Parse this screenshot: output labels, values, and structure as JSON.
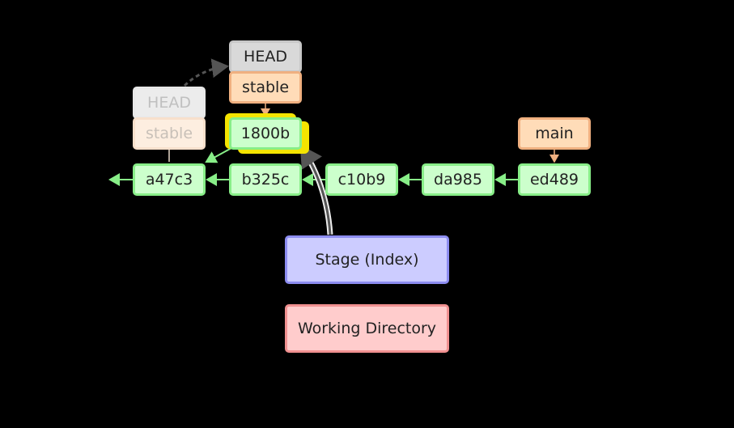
{
  "diagram": {
    "commits": [
      {
        "id": "a47c3"
      },
      {
        "id": "b325c"
      },
      {
        "id": "c10b9"
      },
      {
        "id": "da985"
      },
      {
        "id": "ed489"
      },
      {
        "id": "1800b",
        "highlighted": true
      }
    ],
    "refs": {
      "old_head": "HEAD",
      "old_branch": "stable",
      "new_head": "HEAD",
      "new_branch": "stable",
      "main": "main"
    },
    "areas": {
      "stage": "Stage (Index)",
      "working_directory": "Working Directory"
    },
    "colors": {
      "commit_fill": "#ccffcc",
      "commit_border": "#88ee88",
      "branch_fill": "#ffdcb8",
      "branch_border": "#f0b080",
      "head_fill": "#d9d9d9",
      "stage_fill": "#ccccff",
      "workdir_fill": "#ffcccc",
      "highlight": "#f4e400",
      "background": "#000000"
    }
  }
}
